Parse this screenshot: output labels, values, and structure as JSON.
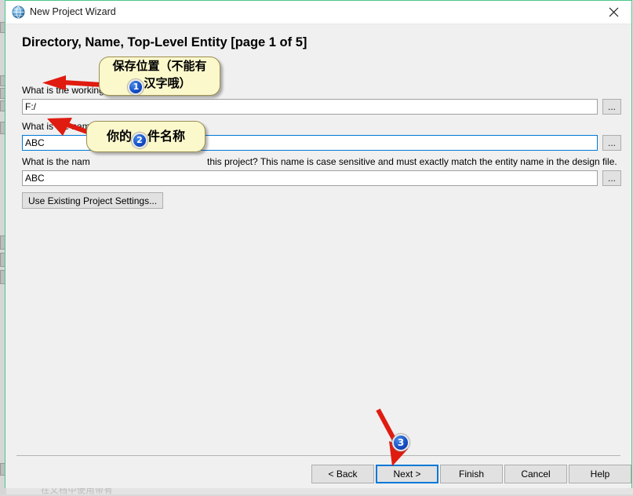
{
  "window": {
    "title": "New Project Wizard",
    "icon": "globe-icon",
    "close_label": "✕",
    "border_color": "#4cc68a"
  },
  "page": {
    "heading": "Directory, Name, Top-Level Entity [page 1 of 5]"
  },
  "fields": [
    {
      "label": "What is the working directory for this project?",
      "label_visible": "What is the working",
      "value": "F:/",
      "placeholder": "",
      "browse_label": "...",
      "focused": false
    },
    {
      "label": "What is the name of this project?",
      "label_visible": "What is the name of this project?",
      "value": "ABC",
      "placeholder": "",
      "browse_label": "...",
      "focused": true
    },
    {
      "label": "What is the name of the top-level design entity for this project? This name is case sensitive and must exactly match the entity name in the design file.",
      "label_visible": "What is the nam",
      "label_tail": "this project? This name is case sensitive and must exactly match the entity name in the design file.",
      "value": "ABC",
      "placeholder": "",
      "browse_label": "...",
      "focused": false
    }
  ],
  "buttons": {
    "use_existing": "Use Existing Project Settings...",
    "back": "< Back",
    "next": "Next >",
    "finish": "Finish",
    "cancel": "Cancel",
    "help": "Help"
  },
  "annotations": {
    "accent_color": "#e01b10",
    "callout_bg": "#fbf8cc",
    "badge_color": "#1550c8",
    "items": [
      {
        "number": "1",
        "text_before": "保存位置（不能有",
        "text_after": "汉字哦）",
        "full_text": "保存位置（不能有汉字哦）",
        "target": "working-directory-input"
      },
      {
        "number": "2",
        "text_before": "你的",
        "text_after": "件名称",
        "full_text": "你的文件名称",
        "target": "project-name-input"
      },
      {
        "number": "3",
        "text_before": "",
        "text_after": "",
        "full_text": "",
        "target": "next-button"
      }
    ]
  },
  "background": {
    "bottom_text": "在文档中使用带有"
  }
}
